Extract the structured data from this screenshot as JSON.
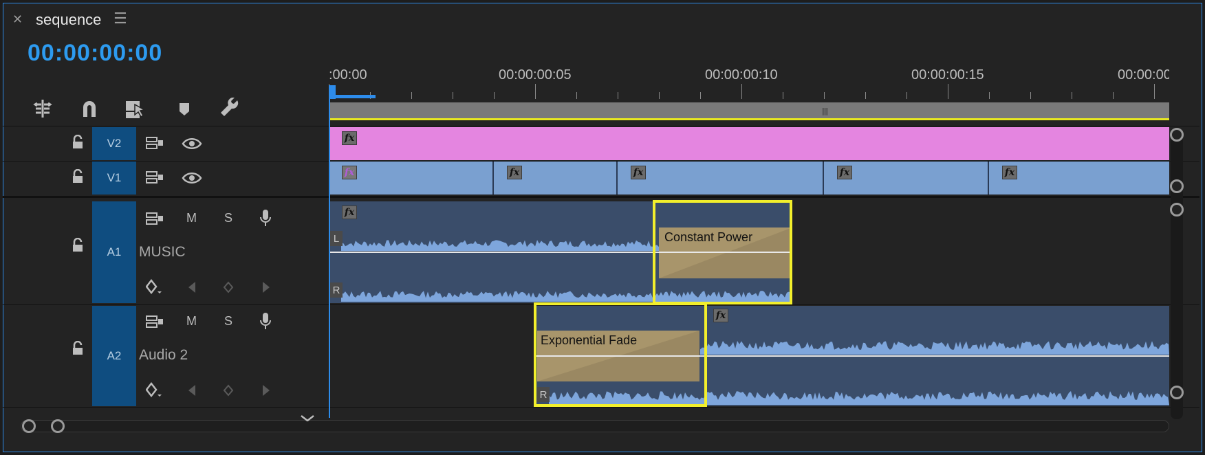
{
  "panel": {
    "title": "sequence",
    "timecode": "00:00:00:00"
  },
  "ruler": {
    "labels": [
      ":00:00",
      "00:00:00:05",
      "00:00:00:10",
      "00:00:00:15",
      "00:00:00"
    ]
  },
  "tracks": {
    "v2": {
      "label": "V2"
    },
    "v1": {
      "label": "V1"
    },
    "a1": {
      "label": "A1",
      "name": "MUSIC",
      "mute": "M",
      "solo": "S"
    },
    "a2": {
      "label": "A2",
      "name": "Audio 2",
      "mute": "M",
      "solo": "S"
    }
  },
  "clips": {
    "fx": "fx",
    "left_channel": "L",
    "right_channel": "R"
  },
  "transitions": {
    "a1": "Constant Power",
    "a2": "Exponential Fade"
  },
  "colors": {
    "accent": "#2d8ceb",
    "timecode": "#2d9bf0",
    "v2_clip": "#e485e0",
    "v1_clip": "#7aa0d0",
    "audio_clip": "#3a4d6a",
    "waveform": "#7ea6dc",
    "transition": "#a8956b",
    "highlight": "#f2ef2c",
    "track_target": "#0f4d80"
  },
  "icons": {
    "close": "close-icon",
    "menu": "hamburger-menu-icon",
    "insert": "nest-insert-icon",
    "snap": "magnet-snap-icon",
    "linked": "linked-selection-icon",
    "marker": "add-marker-icon",
    "settings": "wrench-icon",
    "lock": "lock-icon",
    "sync": "sync-lock-icon",
    "eye": "eye-icon",
    "mic": "microphone-icon",
    "keyframe": "keyframe-icon"
  }
}
